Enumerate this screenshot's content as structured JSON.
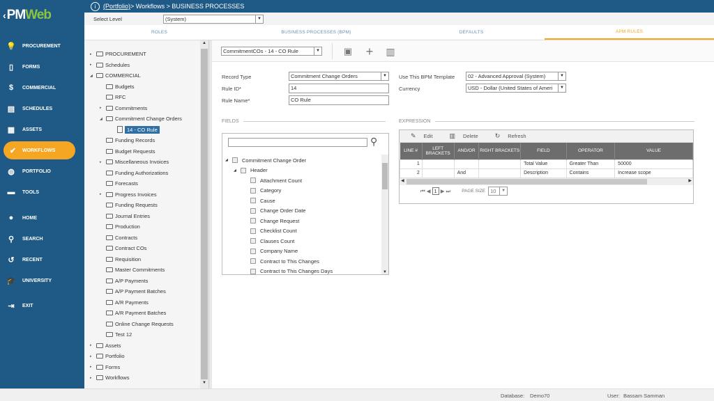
{
  "app": {
    "logo_prefix": "PM",
    "logo_suffix": "Web"
  },
  "nav": [
    {
      "label": "PROCUREMENT",
      "icon": "lightbulb-icon",
      "glyph": "💡"
    },
    {
      "label": "FORMS",
      "icon": "forms-icon",
      "glyph": "▯"
    },
    {
      "label": "COMMERCIAL",
      "icon": "dollar-icon",
      "glyph": "$"
    },
    {
      "label": "SCHEDULES",
      "icon": "schedules-icon",
      "glyph": "▤"
    },
    {
      "label": "ASSETS",
      "icon": "assets-icon",
      "glyph": "▦"
    },
    {
      "label": "WORKFLOWS",
      "icon": "check-icon",
      "glyph": "✔"
    },
    {
      "label": "PORTFOLIO",
      "icon": "globe-icon",
      "glyph": "◍"
    },
    {
      "label": "TOOLS",
      "icon": "toolbox-icon",
      "glyph": "▬"
    },
    {
      "label": "HOME",
      "icon": "home-icon",
      "glyph": "●"
    },
    {
      "label": "SEARCH",
      "icon": "search-icon",
      "glyph": "⚲"
    },
    {
      "label": "RECENT",
      "icon": "history-icon",
      "glyph": "↺"
    },
    {
      "label": "UNIVERSITY",
      "icon": "graduation-cap-icon",
      "glyph": "🎓"
    },
    {
      "label": "EXIT",
      "icon": "exit-icon",
      "glyph": "⇥"
    }
  ],
  "topbar": {
    "breadcrumb_link": "(Portfolio)",
    "breadcrumb_rest": " > Workflows > BUSINESS PROCESSES"
  },
  "level": {
    "label": "Select Level",
    "value": "(System)"
  },
  "tabs": [
    "ROLES",
    "BUSINESS PROCESSES (BPM)",
    "DEFAULTS",
    "APM RULES"
  ],
  "tree": [
    {
      "label": "PROCUREMENT",
      "depth": 0,
      "exp": "▸"
    },
    {
      "label": "Schedules",
      "depth": 0,
      "exp": "▸"
    },
    {
      "label": "COMMERCIAL",
      "depth": 0,
      "exp": "◢"
    },
    {
      "label": "Budgets",
      "depth": 1,
      "exp": ""
    },
    {
      "label": "RFC",
      "depth": 1,
      "exp": ""
    },
    {
      "label": "Commitments",
      "depth": 1,
      "exp": "▸"
    },
    {
      "label": "Commitment Change Orders",
      "depth": 1,
      "exp": "◢"
    },
    {
      "label": "14 - CO Rule",
      "depth": 2,
      "exp": "",
      "doc": true,
      "selected": true
    },
    {
      "label": "Funding Records",
      "depth": 1,
      "exp": ""
    },
    {
      "label": "Budget Requests",
      "depth": 1,
      "exp": ""
    },
    {
      "label": "Miscellaneous Invoices",
      "depth": 1,
      "exp": "▸"
    },
    {
      "label": "Funding Authorizations",
      "depth": 1,
      "exp": ""
    },
    {
      "label": "Forecasts",
      "depth": 1,
      "exp": ""
    },
    {
      "label": "Progress Invoices",
      "depth": 1,
      "exp": "▸"
    },
    {
      "label": "Funding Requests",
      "depth": 1,
      "exp": ""
    },
    {
      "label": "Journal Entries",
      "depth": 1,
      "exp": ""
    },
    {
      "label": "Production",
      "depth": 1,
      "exp": ""
    },
    {
      "label": "Contracts",
      "depth": 1,
      "exp": ""
    },
    {
      "label": "Contract COs",
      "depth": 1,
      "exp": ""
    },
    {
      "label": "Requisition",
      "depth": 1,
      "exp": ""
    },
    {
      "label": "Master Commitments",
      "depth": 1,
      "exp": ""
    },
    {
      "label": "A/P Payments",
      "depth": 1,
      "exp": ""
    },
    {
      "label": "A/P Payment Batches",
      "depth": 1,
      "exp": ""
    },
    {
      "label": "A/R Payments",
      "depth": 1,
      "exp": ""
    },
    {
      "label": "A/R Payment Batches",
      "depth": 1,
      "exp": ""
    },
    {
      "label": "Online Change Requests",
      "depth": 1,
      "exp": ""
    },
    {
      "label": "Test 12",
      "depth": 1,
      "exp": ""
    },
    {
      "label": "Assets",
      "depth": 0,
      "exp": "▸"
    },
    {
      "label": "Portfolio",
      "depth": 0,
      "exp": "▸"
    },
    {
      "label": "Forms",
      "depth": 0,
      "exp": "▸"
    },
    {
      "label": "Workflows",
      "depth": 0,
      "exp": "▸"
    }
  ],
  "record_select": "CommitmentCOs - 14 - CO Rule",
  "form": {
    "record_type_label": "Record Type",
    "record_type": "Commitment Change Orders",
    "rule_id_label": "Rule ID*",
    "rule_id": "14",
    "rule_name_label": "Rule Name*",
    "rule_name": "CO Rule",
    "template_label": "Use This BPM Template",
    "template": "02 - Advanced Approval (System)",
    "currency_label": "Currency",
    "currency": "USD - Dollar (United States of Ameri"
  },
  "fields_title": "FIELDS",
  "expression_title": "EXPRESSION",
  "fields": [
    {
      "label": "Commitment Change Order",
      "depth": 0,
      "exp": "◢"
    },
    {
      "label": "Header",
      "depth": 1,
      "exp": "◢"
    },
    {
      "label": "Attachment Count",
      "depth": 2,
      "exp": ""
    },
    {
      "label": "Category",
      "depth": 2,
      "exp": ""
    },
    {
      "label": "Cause",
      "depth": 2,
      "exp": ""
    },
    {
      "label": "Change Order Date",
      "depth": 2,
      "exp": ""
    },
    {
      "label": "Change Request",
      "depth": 2,
      "exp": ""
    },
    {
      "label": "Checklist Count",
      "depth": 2,
      "exp": ""
    },
    {
      "label": "Clauses Count",
      "depth": 2,
      "exp": ""
    },
    {
      "label": "Company Name",
      "depth": 2,
      "exp": ""
    },
    {
      "label": "Contract to This Changes",
      "depth": 2,
      "exp": ""
    },
    {
      "label": "Contract to This Changes Days",
      "depth": 2,
      "exp": ""
    }
  ],
  "expr_tools": {
    "edit": "Edit",
    "delete": "Delete",
    "refresh": "Refresh"
  },
  "expr_headers": [
    "LINE #",
    "LEFT BRACKETS",
    "AND/OR",
    "RIGHT BRACKETS",
    "FIELD",
    "OPERATOR",
    "VALUE"
  ],
  "expr_rows": [
    [
      "1",
      "",
      "",
      "",
      "Total Value",
      "Greater Than",
      "50000"
    ],
    [
      "2",
      "",
      "And",
      "",
      "Description",
      "Contains",
      "Increase scope"
    ]
  ],
  "pager": {
    "page": "1",
    "size_label": "PAGE SIZE",
    "size": "10"
  },
  "status": {
    "db_label": "Database:",
    "db": "Demo70",
    "user_label": "User:",
    "user": "Bassam Samman"
  }
}
